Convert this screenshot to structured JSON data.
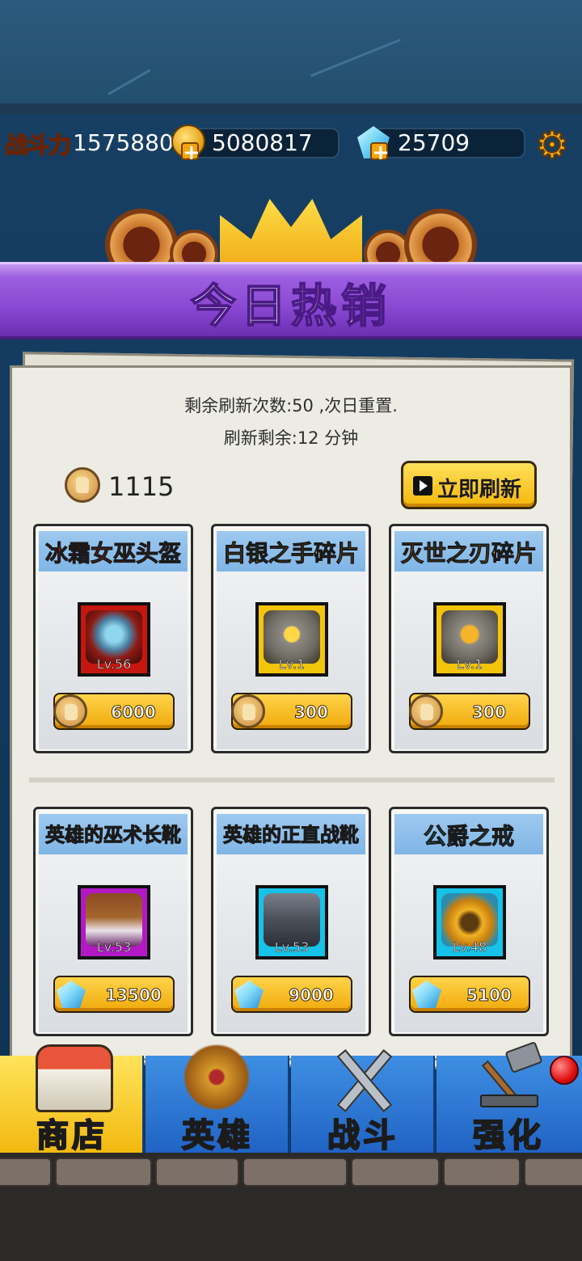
{
  "resources": {
    "power_label": "战斗力",
    "power_value": "1575880",
    "coins": "5080817",
    "gems": "25709"
  },
  "banner": {
    "title": "今日热销"
  },
  "shop": {
    "refresh_info": "剩余刷新次数:50 ,次日重置.",
    "refresh_timer": "刷新剩余:12 分钟",
    "currency_value": "1115",
    "refresh_button": "立即刷新",
    "items": [
      {
        "name": "冰霜女巫头盔",
        "level": "Lv.56",
        "price": "6000",
        "currency": "hand-coin",
        "name_color": "#e0201c",
        "frame_color": "#c4170f"
      },
      {
        "name": "白银之手碎片",
        "level": "Lv.1",
        "price": "300",
        "currency": "hand-coin",
        "name_color": "#f0a20a",
        "frame_color": "#f2c40a"
      },
      {
        "name": "灭世之刃碎片",
        "level": "Lv.1",
        "price": "300",
        "currency": "hand-coin",
        "name_color": "#f0a20a",
        "frame_color": "#f2c40a"
      },
      {
        "name": "英雄的巫术长靴",
        "level": "Lv.53",
        "price": "13500",
        "currency": "gem",
        "name_color": "#e0219a",
        "frame_color": "#b219c4"
      },
      {
        "name": "英雄的正直战靴",
        "level": "Lv.53",
        "price": "9000",
        "currency": "gem",
        "name_color": "#1ac8e6",
        "frame_color": "#16c2e8"
      },
      {
        "name": "公爵之戒",
        "level": "Lv.48",
        "price": "5100",
        "currency": "gem",
        "name_color": "#1ac8e6",
        "frame_color": "#16c2e8"
      }
    ]
  },
  "nav": {
    "tabs": [
      {
        "label": "商店",
        "icon": "shop-icon",
        "active": true
      },
      {
        "label": "英雄",
        "icon": "helmet-icon",
        "active": false
      },
      {
        "label": "战斗",
        "icon": "crossed-swords-icon",
        "active": false
      },
      {
        "label": "强化",
        "icon": "hammer-icon",
        "active": false
      }
    ]
  }
}
